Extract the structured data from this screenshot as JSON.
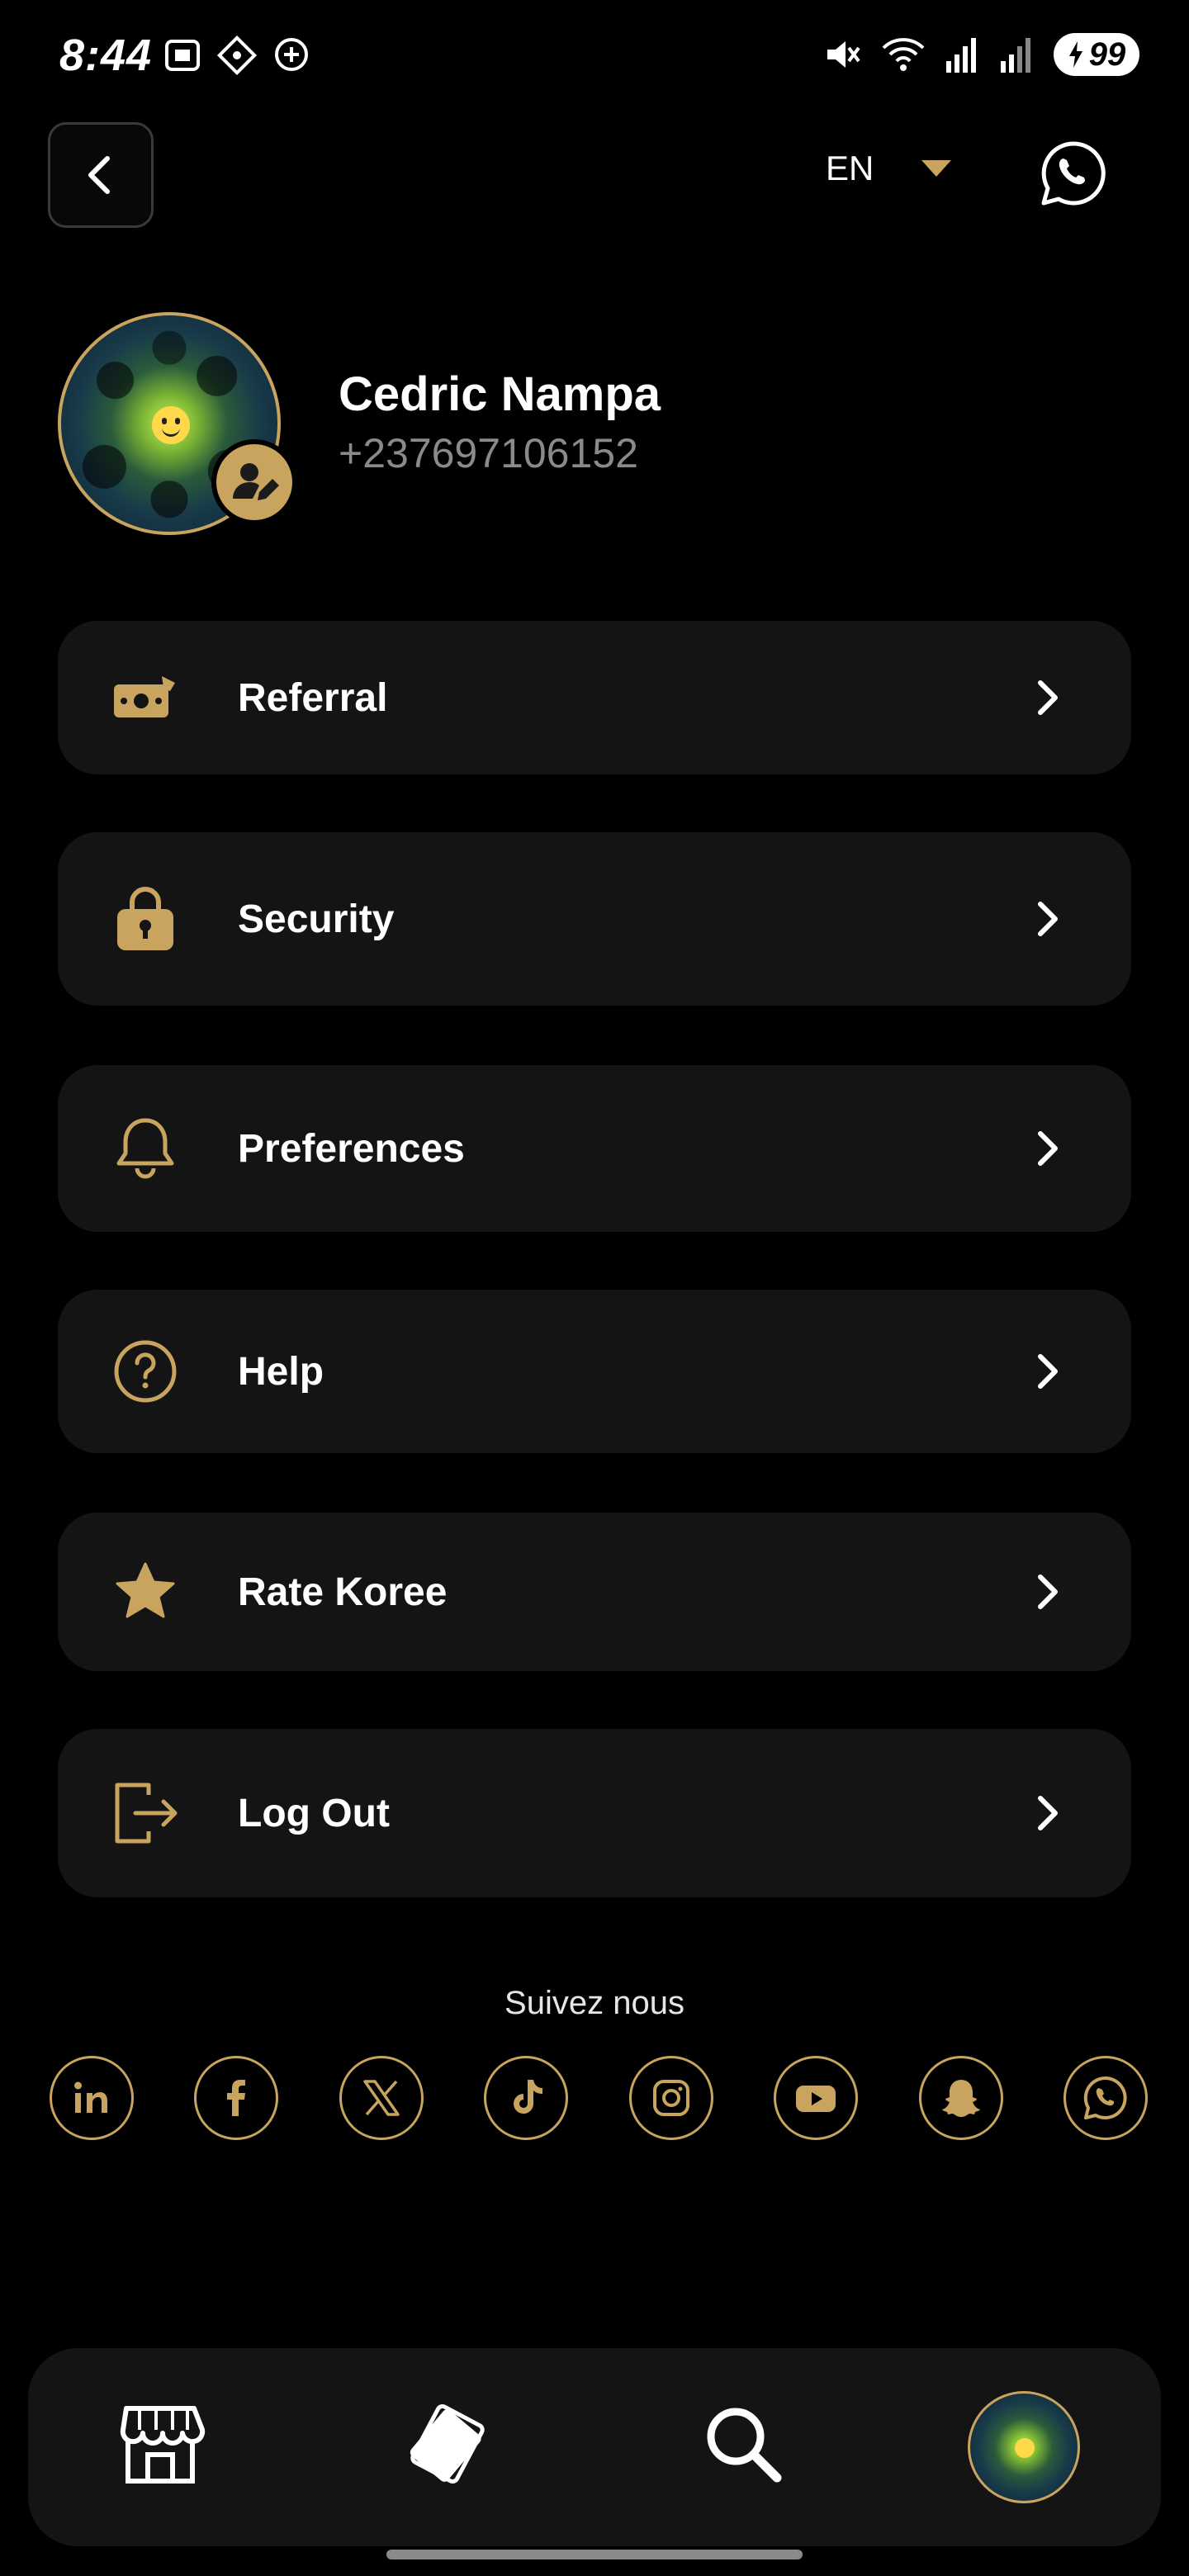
{
  "status_bar": {
    "time": "8:44",
    "battery": "99"
  },
  "header": {
    "language": "EN"
  },
  "profile": {
    "name": "Cedric Nampa",
    "phone": "+237697106152"
  },
  "menu": {
    "items": [
      {
        "label": "Referral",
        "icon": "money-icon"
      },
      {
        "label": "Security",
        "icon": "lock-icon"
      },
      {
        "label": "Preferences",
        "icon": "bell-icon"
      },
      {
        "label": "Help",
        "icon": "help-icon"
      },
      {
        "label": "Rate Koree",
        "icon": "star-icon"
      },
      {
        "label": "Log Out",
        "icon": "logout-icon"
      }
    ]
  },
  "social": {
    "title": "Suivez nous",
    "networks": [
      "linkedin",
      "facebook",
      "x",
      "tiktok",
      "instagram",
      "youtube",
      "snapchat",
      "whatsapp"
    ]
  },
  "colors": {
    "accent": "#c9a45f",
    "background": "#000000",
    "card": "#141414"
  }
}
